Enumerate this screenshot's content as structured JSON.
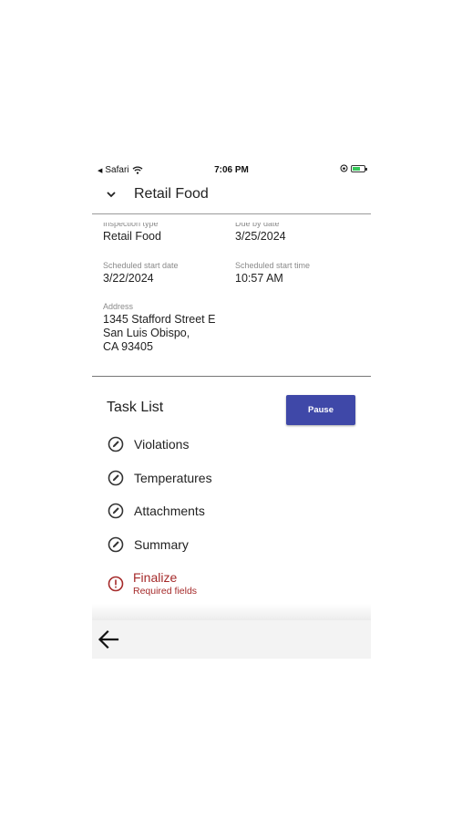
{
  "status_bar": {
    "back_app": "Safari",
    "time": "7:06 PM"
  },
  "header": {
    "title": "Retail Food"
  },
  "details": {
    "inspection_type": {
      "label": "Inspection type",
      "value": "Retail Food"
    },
    "due_by_date": {
      "label": "Due by date",
      "value": "3/25/2024"
    },
    "scheduled_start_date": {
      "label": "Scheduled start date",
      "value": "3/22/2024"
    },
    "scheduled_start_time": {
      "label": "Scheduled start time",
      "value": "10:57 AM"
    },
    "address": {
      "label": "Address",
      "line1": "1345 Stafford Street E",
      "line2": "San Luis Obispo,",
      "line3": "CA 93405"
    }
  },
  "task_list": {
    "title": "Task List",
    "pause_label": "Pause",
    "items": [
      {
        "label": "Violations",
        "icon": "pencil-circle-icon"
      },
      {
        "label": "Temperatures",
        "icon": "pencil-circle-icon"
      },
      {
        "label": "Attachments",
        "icon": "pencil-circle-icon"
      },
      {
        "label": "Summary",
        "icon": "pencil-circle-icon"
      }
    ],
    "finalize": {
      "label": "Finalize",
      "sub": "Required fields",
      "icon": "alert-circle-icon",
      "color": "#a52a2a"
    }
  },
  "colors": {
    "accent": "#3f48a8",
    "error": "#a52a2a"
  }
}
